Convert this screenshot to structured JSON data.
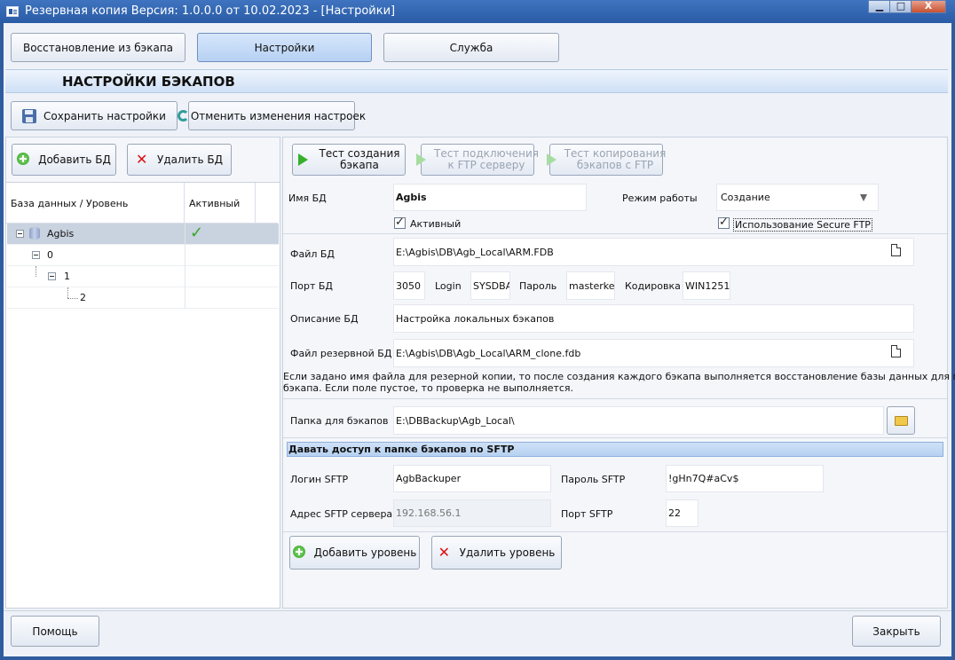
{
  "window": {
    "title": "Резервная копия   Версия: 1.0.0.0 от 10.02.2023 - [Настройки]",
    "minimize": "▁",
    "maximize": "□",
    "close": "X"
  },
  "tabs": [
    {
      "label": "Восстановление из бэкапа",
      "active": false
    },
    {
      "label": "Настройки",
      "active": true
    },
    {
      "label": "Служба",
      "active": false
    }
  ],
  "section_title": "НАСТРОЙКИ БЭКАПОВ",
  "toolbar": {
    "save_label": "Сохранить настройки",
    "cancel_label": "Отменить изменения настроек"
  },
  "left": {
    "add_db_label": "Добавить БД",
    "remove_db_label": "Удалить БД",
    "tree_headers": [
      "База данных / Уровень",
      "Активный"
    ],
    "tree_rows": [
      {
        "label": "Agbis",
        "active": "✓"
      },
      {
        "label": "0",
        "active": ""
      },
      {
        "label": "1",
        "active": ""
      },
      {
        "label": "2",
        "active": ""
      }
    ]
  },
  "tests": {
    "create_backup": "Тест создания\nбэкапа",
    "ftp_connect": "Тест подключения\nк FTP серверу",
    "copy_ftp": "Тест копирования\nбэкапов с FTP"
  },
  "form": {
    "db_name_label": "Имя БД",
    "db_name": "Agbis",
    "mode_label": "Режим работы",
    "mode_value": "Создание",
    "active_label": "Активный",
    "secure_ftp_label": "Использование Secure FTP",
    "db_file_label": "Файл БД",
    "db_file": "E:\\Agbis\\DB\\Agb_Local\\ARM.FDB",
    "port_label": "Порт БД",
    "port": "3050",
    "login_label": "Login",
    "login": "SYSDBA",
    "password_label": "Пароль",
    "password": "masterkey",
    "encoding_label": "Кодировка",
    "encoding": "WIN1251",
    "description_label": "Описание БД",
    "description": "Настройка локальных бэкапов",
    "backup_file_label": "Файл резервной БД",
    "backup_file": "E:\\Agbis\\DB\\Agb_Local\\ARM_clone.fdb",
    "hint_line1": "Если задано имя файла для резерной копии, то после создания каждого бэкапа выполняется восстановление базы данных для проверки",
    "hint_line2": "бэкапа. Если поле пустое, то проверка не выполняется.",
    "backup_folder_label": "Папка для бэкапов",
    "backup_folder": "E:\\DBBackup\\Agb_Local\\"
  },
  "sftp": {
    "header": "Давать доступ к папке бэкапов по SFTP",
    "login_label": "Логин SFTP",
    "login": "AgbBackuper",
    "password_label": "Пароль SFTP",
    "password": "!gHn7Q#aCv$",
    "address_label": "Адрес SFTP сервера",
    "address": "192.168.56.1",
    "port_label": "Порт SFTP",
    "port": "22"
  },
  "levels": {
    "add_label": "Добавить уровень",
    "remove_label": "Удалить уровень"
  },
  "footer": {
    "help_label": "Помощь",
    "close_label": "Закрыть"
  },
  "colors": {
    "title_bar": "#2a5ba5",
    "section_header": "#dbe8f8",
    "active_tab": "#c5dbf6",
    "check_green": "#3aa52b"
  }
}
